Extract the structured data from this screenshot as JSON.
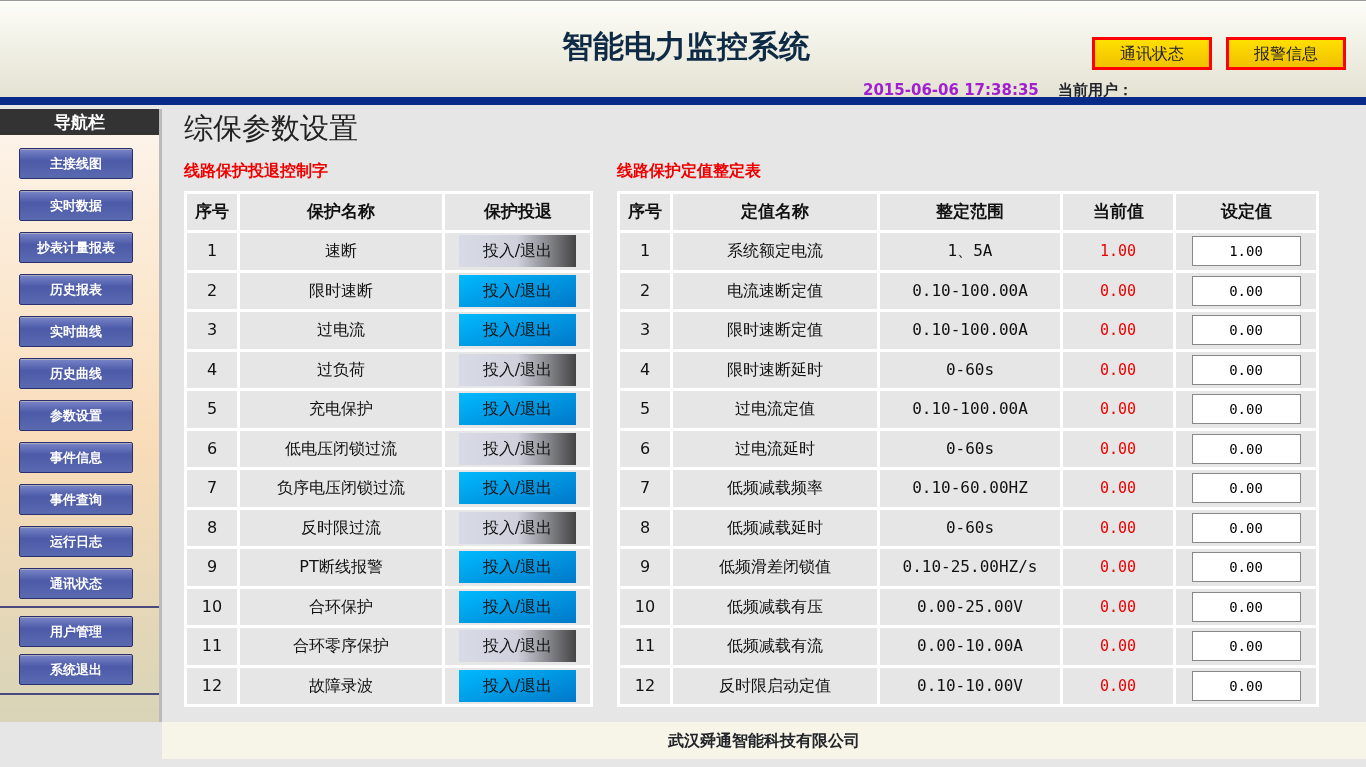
{
  "header": {
    "title": "智能电力监控系统",
    "buttons": [
      "通讯状态",
      "报警信息"
    ],
    "datetime": "2015-06-06 17:38:35",
    "user_label": "当前用户："
  },
  "sidebar": {
    "title": "导航栏",
    "items": [
      "主接线图",
      "实时数据",
      "抄表计量报表",
      "历史报表",
      "实时曲线",
      "历史曲线",
      "参数设置",
      "事件信息",
      "事件查询",
      "运行日志",
      "通讯状态"
    ],
    "system_items": [
      "用户管理",
      "系统退出"
    ]
  },
  "page_title": "综保参数设置",
  "control_table": {
    "title": "线路保护投退控制字",
    "columns": [
      "序号",
      "保护名称",
      "保护投退"
    ],
    "rows": [
      {
        "no": "1",
        "name": "速断",
        "toggle": "投入/退出",
        "on": false
      },
      {
        "no": "2",
        "name": "限时速断",
        "toggle": "投入/退出",
        "on": true
      },
      {
        "no": "3",
        "name": "过电流",
        "toggle": "投入/退出",
        "on": true
      },
      {
        "no": "4",
        "name": "过负荷",
        "toggle": "投入/退出",
        "on": false
      },
      {
        "no": "5",
        "name": "充电保护",
        "toggle": "投入/退出",
        "on": true
      },
      {
        "no": "6",
        "name": "低电压闭锁过流",
        "toggle": "投入/退出",
        "on": false
      },
      {
        "no": "7",
        "name": "负序电压闭锁过流",
        "toggle": "投入/退出",
        "on": true
      },
      {
        "no": "8",
        "name": "反时限过流",
        "toggle": "投入/退出",
        "on": false
      },
      {
        "no": "9",
        "name": "PT断线报警",
        "toggle": "投入/退出",
        "on": true
      },
      {
        "no": "10",
        "name": "合环保护",
        "toggle": "投入/退出",
        "on": true
      },
      {
        "no": "11",
        "name": "合环零序保护",
        "toggle": "投入/退出",
        "on": false
      },
      {
        "no": "12",
        "name": "故障录波",
        "toggle": "投入/退出",
        "on": true
      }
    ]
  },
  "setting_table": {
    "title": "线路保护定值整定表",
    "columns": [
      "序号",
      "定值名称",
      "整定范围",
      "当前值",
      "设定值"
    ],
    "rows": [
      {
        "no": "1",
        "name": "系统额定电流",
        "range": "1、5A",
        "current": "1.00",
        "value": "1.00"
      },
      {
        "no": "2",
        "name": "电流速断定值",
        "range": "0.10-100.00A",
        "current": "0.00",
        "value": "0.00"
      },
      {
        "no": "3",
        "name": "限时速断定值",
        "range": "0.10-100.00A",
        "current": "0.00",
        "value": "0.00"
      },
      {
        "no": "4",
        "name": "限时速断延时",
        "range": "0-60s",
        "current": "0.00",
        "value": "0.00"
      },
      {
        "no": "5",
        "name": "过电流定值",
        "range": "0.10-100.00A",
        "current": "0.00",
        "value": "0.00"
      },
      {
        "no": "6",
        "name": "过电流延时",
        "range": "0-60s",
        "current": "0.00",
        "value": "0.00"
      },
      {
        "no": "7",
        "name": "低频减载频率",
        "range": "0.10-60.00HZ",
        "current": "0.00",
        "value": "0.00"
      },
      {
        "no": "8",
        "name": "低频减载延时",
        "range": "0-60s",
        "current": "0.00",
        "value": "0.00"
      },
      {
        "no": "9",
        "name": "低频滑差闭锁值",
        "range": "0.10-25.00HZ/s",
        "current": "0.00",
        "value": "0.00"
      },
      {
        "no": "10",
        "name": "低频减载有压",
        "range": "0.00-25.00V",
        "current": "0.00",
        "value": "0.00"
      },
      {
        "no": "11",
        "name": "低频减载有流",
        "range": "0.00-10.00A",
        "current": "0.00",
        "value": "0.00"
      },
      {
        "no": "12",
        "name": "反时限启动定值",
        "range": "0.10-10.00V",
        "current": "0.00",
        "value": "0.00"
      }
    ]
  },
  "footer": "武汉舜通智能科技有限公司"
}
